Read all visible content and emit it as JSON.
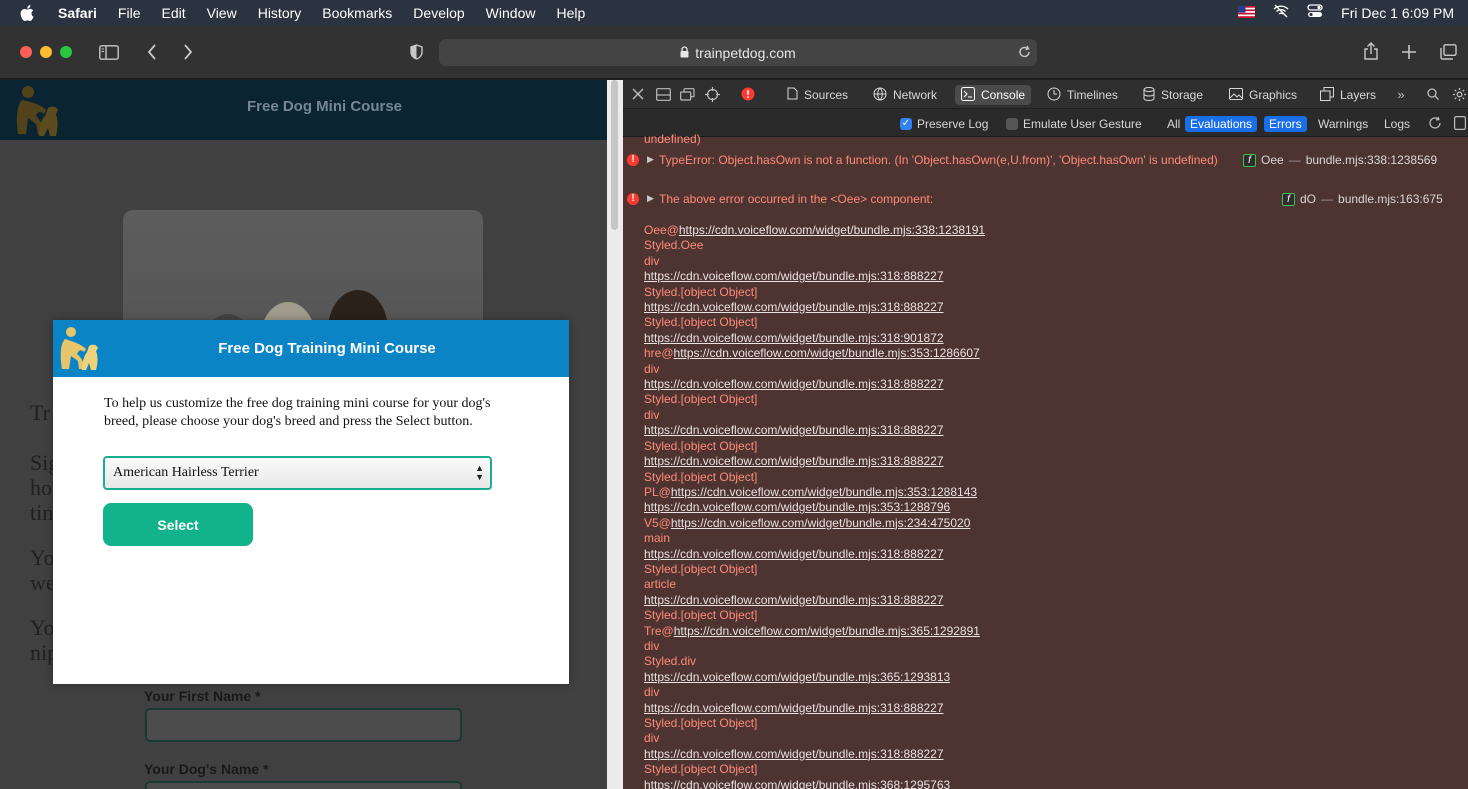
{
  "menubar": {
    "app": "Safari",
    "items": [
      "File",
      "Edit",
      "View",
      "History",
      "Bookmarks",
      "Develop",
      "Window",
      "Help"
    ],
    "datetime": "Fri Dec 1  6:09 PM"
  },
  "browser": {
    "url": "trainpetdog.com"
  },
  "site": {
    "header_title": "Free Dog Mini Course",
    "fragments": [
      "Tr",
      "Sig",
      "ho",
      "tin",
      "Yo",
      "we",
      "Yo",
      "nip"
    ],
    "labels": [
      "Your First Name *",
      "Your Dog's Name *"
    ]
  },
  "modal": {
    "title": "Free Dog Training Mini Course",
    "text": "To help us customize the free dog training mini course for your dog's breed, please choose your dog's breed and press the Select button.",
    "selected_breed": "American Hairless Terrier",
    "button": "Select"
  },
  "inspector": {
    "tabs": [
      {
        "label": "Sources",
        "icon": "file-icon"
      },
      {
        "label": "Network",
        "icon": "network-icon"
      },
      {
        "label": "Console",
        "icon": "console-icon"
      },
      {
        "label": "Timelines",
        "icon": "clock-icon"
      },
      {
        "label": "Storage",
        "icon": "database-icon"
      },
      {
        "label": "Graphics",
        "icon": "image-icon"
      },
      {
        "label": "Layers",
        "icon": "layers-icon"
      }
    ],
    "active_tab": "Console",
    "filter": {
      "preserve_log": "Preserve Log",
      "emulate_gesture": "Emulate User Gesture",
      "levels": [
        "All",
        "Evaluations",
        "Errors",
        "Warnings",
        "Logs"
      ]
    },
    "console": {
      "top_fragment": "undefined)",
      "messages": [
        {
          "text": "TypeError: Object.hasOwn is not a function. (In 'Object.hasOwn(e,U.from)', 'Object.hasOwn' is undefined)",
          "func": "Oee",
          "source": "bundle.mjs:338:1238569"
        },
        {
          "text": "The above error occurred in the <Oee> component:",
          "func": "dO",
          "source": "bundle.mjs:163:675"
        }
      ],
      "stack": [
        [
          "Oee@",
          "https://cdn.voiceflow.com/widget/bundle.mjs:338:1238191"
        ],
        [
          "Styled.Oee",
          ""
        ],
        [
          "div",
          ""
        ],
        [
          "",
          "https://cdn.voiceflow.com/widget/bundle.mjs:318:888227"
        ],
        [
          "Styled.[object Object]",
          ""
        ],
        [
          "",
          "https://cdn.voiceflow.com/widget/bundle.mjs:318:888227"
        ],
        [
          "Styled.[object Object]",
          ""
        ],
        [
          "",
          "https://cdn.voiceflow.com/widget/bundle.mjs:318:901872"
        ],
        [
          "hre@",
          "https://cdn.voiceflow.com/widget/bundle.mjs:353:1286607"
        ],
        [
          "div",
          ""
        ],
        [
          "",
          "https://cdn.voiceflow.com/widget/bundle.mjs:318:888227"
        ],
        [
          "Styled.[object Object]",
          ""
        ],
        [
          "div",
          ""
        ],
        [
          "",
          "https://cdn.voiceflow.com/widget/bundle.mjs:318:888227"
        ],
        [
          "Styled.[object Object]",
          ""
        ],
        [
          "",
          "https://cdn.voiceflow.com/widget/bundle.mjs:318:888227"
        ],
        [
          "Styled.[object Object]",
          ""
        ],
        [
          "PL@",
          "https://cdn.voiceflow.com/widget/bundle.mjs:353:1288143"
        ],
        [
          "",
          "https://cdn.voiceflow.com/widget/bundle.mjs:353:1288796"
        ],
        [
          "V5@",
          "https://cdn.voiceflow.com/widget/bundle.mjs:234:475020"
        ],
        [
          "main",
          ""
        ],
        [
          "",
          "https://cdn.voiceflow.com/widget/bundle.mjs:318:888227"
        ],
        [
          "Styled.[object Object]",
          ""
        ],
        [
          "article",
          ""
        ],
        [
          "",
          "https://cdn.voiceflow.com/widget/bundle.mjs:318:888227"
        ],
        [
          "Styled.[object Object]",
          ""
        ],
        [
          "Tre@",
          "https://cdn.voiceflow.com/widget/bundle.mjs:365:1292891"
        ],
        [
          "div",
          ""
        ],
        [
          "Styled.div",
          ""
        ],
        [
          "",
          "https://cdn.voiceflow.com/widget/bundle.mjs:365:1293813"
        ],
        [
          "div",
          ""
        ],
        [
          "",
          "https://cdn.voiceflow.com/widget/bundle.mjs:318:888227"
        ],
        [
          "Styled.[object Object]",
          ""
        ],
        [
          "div",
          ""
        ],
        [
          "",
          "https://cdn.voiceflow.com/widget/bundle.mjs:318:888227"
        ],
        [
          "Styled.[object Object]",
          ""
        ],
        [
          "",
          "https://cdn.voiceflow.com/widget/bundle.mjs:368:1295763"
        ]
      ]
    }
  },
  "colors": {
    "modal_header": "#0b84c6",
    "select_button": "#12b38a",
    "console_error_bg": "#4d3431",
    "error_text": "#ff8a7a"
  }
}
